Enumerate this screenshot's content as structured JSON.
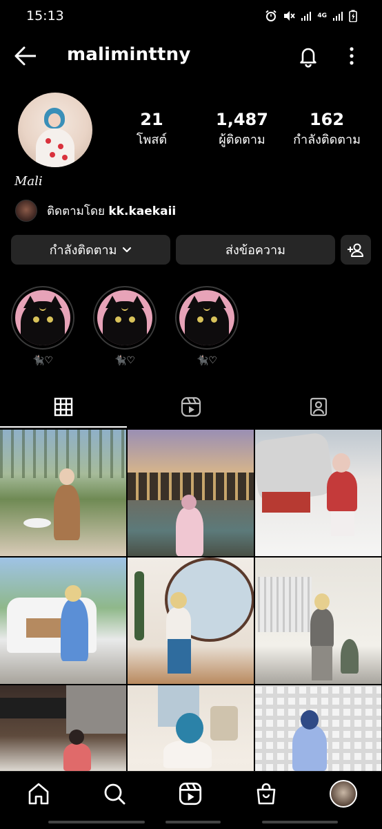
{
  "status_bar": {
    "time": "15:13",
    "network": "4G"
  },
  "header": {
    "username": "maliminttny",
    "icons": [
      "back-arrow-icon",
      "bell-icon",
      "more-vertical-icon"
    ]
  },
  "profile": {
    "stats": [
      {
        "value": "21",
        "label": "โพสต์"
      },
      {
        "value": "1,487",
        "label": "ผู้ติดตาม"
      },
      {
        "value": "162",
        "label": "กำลังติดตาม"
      }
    ],
    "display_name": "Mali",
    "followed_by_prefix": "ติดตามโดย ",
    "followed_by_user": "kk.kaekaii"
  },
  "actions": {
    "following_label": "กำลังติดตาม",
    "message_label": "ส่งข้อความ"
  },
  "highlights": [
    {
      "label": "🐈‍⬛♡"
    },
    {
      "label": "🐈‍⬛♡"
    },
    {
      "label": "🐈‍⬛♡"
    }
  ],
  "tabs": [
    "grid-icon",
    "reels-icon",
    "tagged-icon"
  ],
  "grid_posts": [
    {
      "colors": [
        "#8fb0c8",
        "#6f8a54",
        "#d9cbb8"
      ]
    },
    {
      "colors": [
        "#9a8fb4",
        "#d7b58a",
        "#5c7a7a"
      ]
    },
    {
      "colors": [
        "#bfc8d0",
        "#e8e6e4",
        "#c43a3a"
      ]
    },
    {
      "colors": [
        "#9fc3e6",
        "#e9eaea",
        "#5b8fd6"
      ]
    },
    {
      "colors": [
        "#f1ece6",
        "#a8764c",
        "#2f6c9e"
      ]
    },
    {
      "colors": [
        "#e7e4dd",
        "#8d8a84",
        "#5f6d5a"
      ]
    },
    {
      "colors": [
        "#3a2d28",
        "#e7e4dd",
        "#e06a6a"
      ]
    },
    {
      "colors": [
        "#e9e2d8",
        "#b7c9d6",
        "#f2f2f2"
      ]
    },
    {
      "colors": [
        "#d8d8d8",
        "#f4f4f4",
        "#9bb4e6"
      ]
    }
  ],
  "bottom_nav": [
    "home-icon",
    "search-icon",
    "reels-icon",
    "shop-icon",
    "profile-avatar"
  ]
}
